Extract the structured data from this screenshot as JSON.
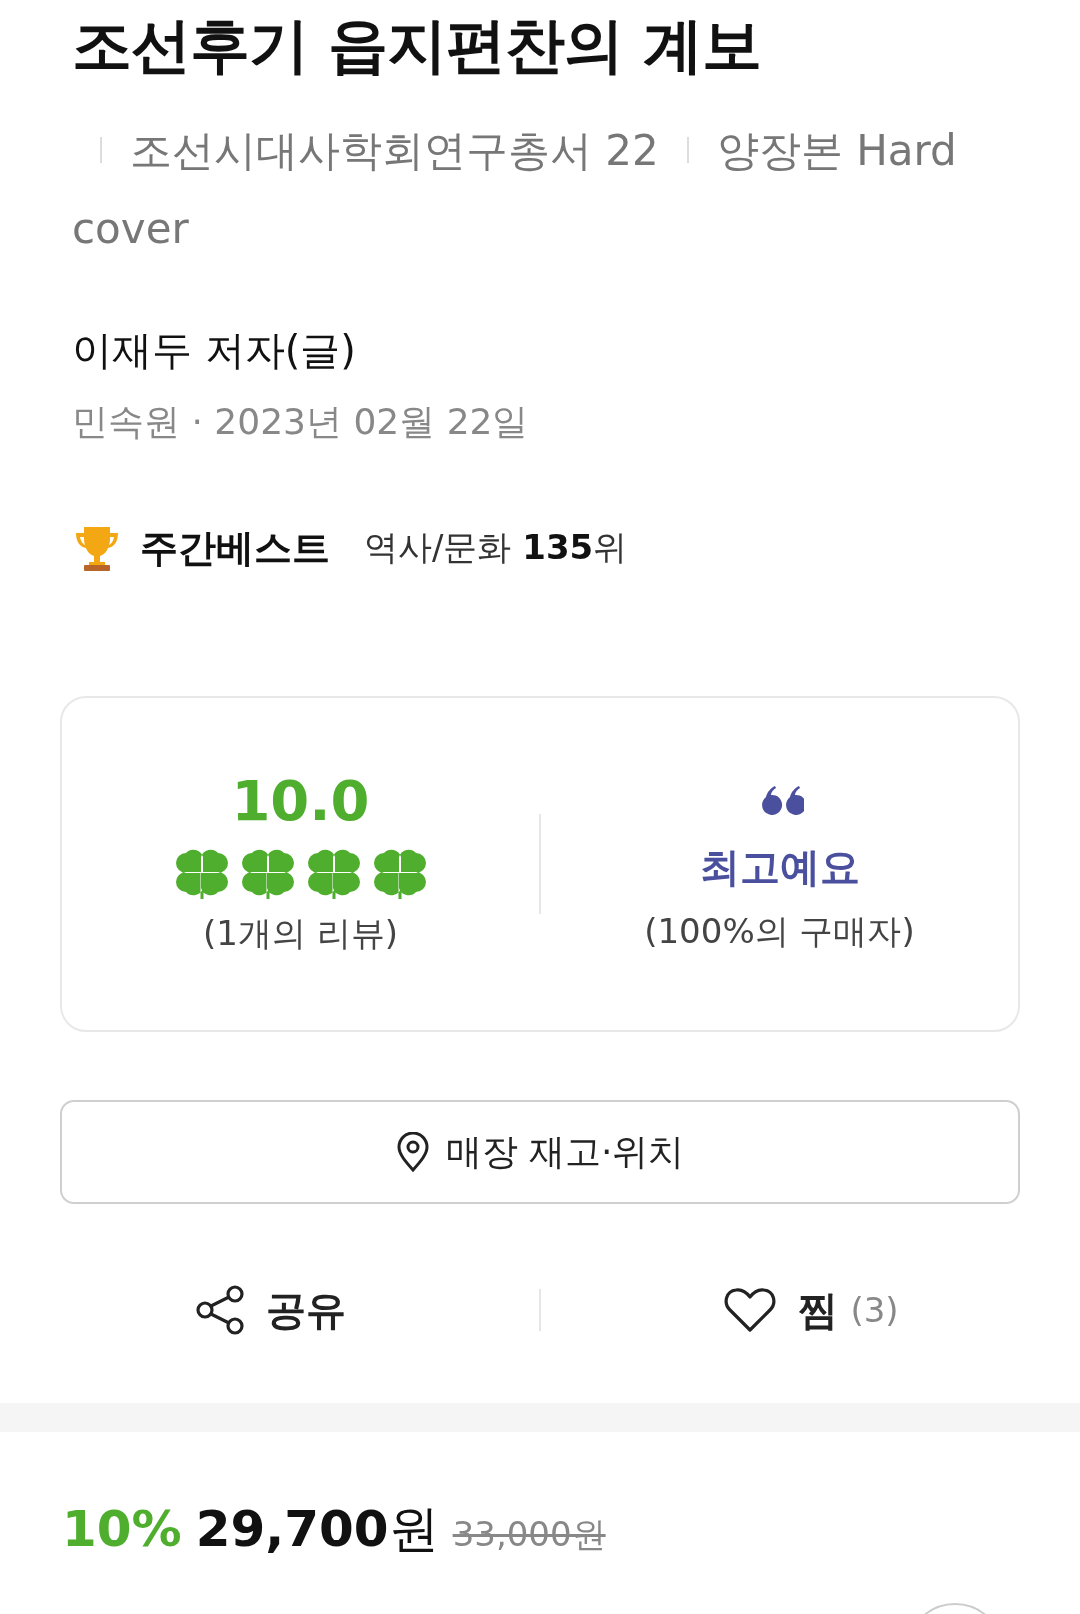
{
  "title": "조선후기 읍지편찬의 계보",
  "series_info": [
    "조선시대사학회연구총서 22",
    "양장본 Hard cover"
  ],
  "author": "이재두 저자(글)",
  "publisher_date": "민속원 · 2023년 02월 22일",
  "bestseller": {
    "label": "주간베스트",
    "category": "역사/문화",
    "rank": "135",
    "rank_unit": "위"
  },
  "rating": {
    "score": "10.0",
    "stars": 4,
    "review_count": "(1개의 리뷰)"
  },
  "review_keyword": {
    "label": "최고예요",
    "share": "(100%의 구매자)"
  },
  "store_button": "매장 재고·위치",
  "actions": {
    "share": "공유",
    "wish": "찜",
    "wish_count": "(3)"
  },
  "price": {
    "discount": "10%",
    "sale": "29,700",
    "sale_unit": "원",
    "original": "33,000원"
  }
}
